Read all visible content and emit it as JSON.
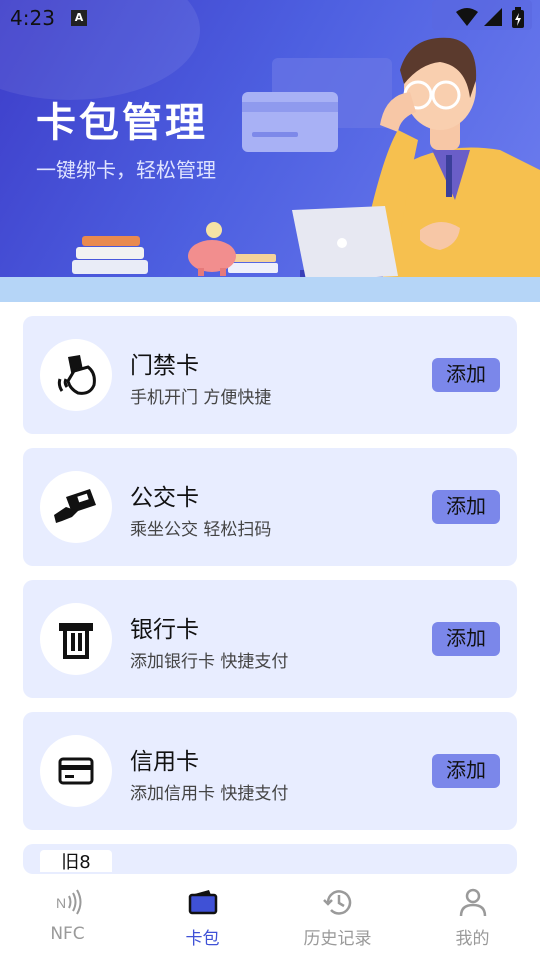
{
  "status_bar": {
    "time": "4:23",
    "a_badge": "A"
  },
  "banner": {
    "title": "卡包管理",
    "subtitle": "一键绑卡，轻松管理"
  },
  "cards": [
    {
      "title": "门禁卡",
      "desc": "手机开门 方便快捷",
      "button": "添加",
      "icon": "hand-tap-card-icon"
    },
    {
      "title": "公交卡",
      "desc": "乘坐公交 轻松扫码",
      "button": "添加",
      "icon": "hand-holding-card-icon"
    },
    {
      "title": "银行卡",
      "desc": "添加银行卡 快捷支付",
      "button": "添加",
      "icon": "atm-card-icon"
    },
    {
      "title": "信用卡",
      "desc": "添加信用卡 快捷支付",
      "button": "添加",
      "icon": "credit-card-icon"
    }
  ],
  "partial_card": {
    "icon_text": "旧8"
  },
  "nav": [
    {
      "label": "NFC",
      "icon": "nfc-icon",
      "active": false
    },
    {
      "label": "卡包",
      "icon": "wallet-icon",
      "active": true
    },
    {
      "label": "历史记录",
      "icon": "history-icon",
      "active": false
    },
    {
      "label": "我的",
      "icon": "user-icon",
      "active": false
    }
  ],
  "colors": {
    "accent": "#3f51d6",
    "card_bg": "#e8edff",
    "button_bg": "#7b87ea",
    "banner": "#4d5fe0"
  }
}
